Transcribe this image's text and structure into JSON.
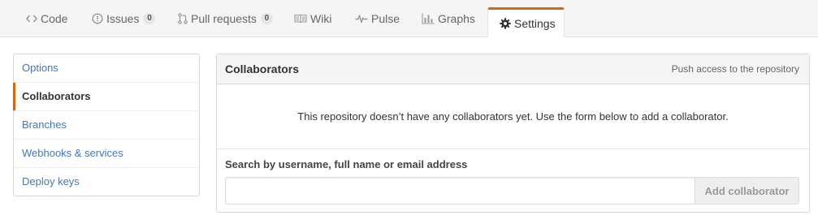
{
  "tabs": [
    {
      "label": "Code",
      "icon": "code-icon"
    },
    {
      "label": "Issues",
      "icon": "issue-opened-icon",
      "count": "0"
    },
    {
      "label": "Pull requests",
      "icon": "git-pull-request-icon",
      "count": "0"
    },
    {
      "label": "Wiki",
      "icon": "book-icon"
    },
    {
      "label": "Pulse",
      "icon": "pulse-icon"
    },
    {
      "label": "Graphs",
      "icon": "graph-icon"
    },
    {
      "label": "Settings",
      "icon": "gear-icon",
      "selected": true
    }
  ],
  "sidebar": {
    "items": [
      {
        "label": "Options"
      },
      {
        "label": "Collaborators",
        "selected": true
      },
      {
        "label": "Branches"
      },
      {
        "label": "Webhooks & services"
      },
      {
        "label": "Deploy keys"
      }
    ]
  },
  "collaborators": {
    "title": "Collaborators",
    "note": "Push access to the repository",
    "empty_message": "This repository doesn’t have any collaborators yet. Use the form below to add a collaborator.",
    "search_label": "Search by username, full name or email address",
    "search_value": "",
    "add_button": "Add collaborator"
  },
  "colors": {
    "accent": "#d26911",
    "link": "#4078c0"
  }
}
